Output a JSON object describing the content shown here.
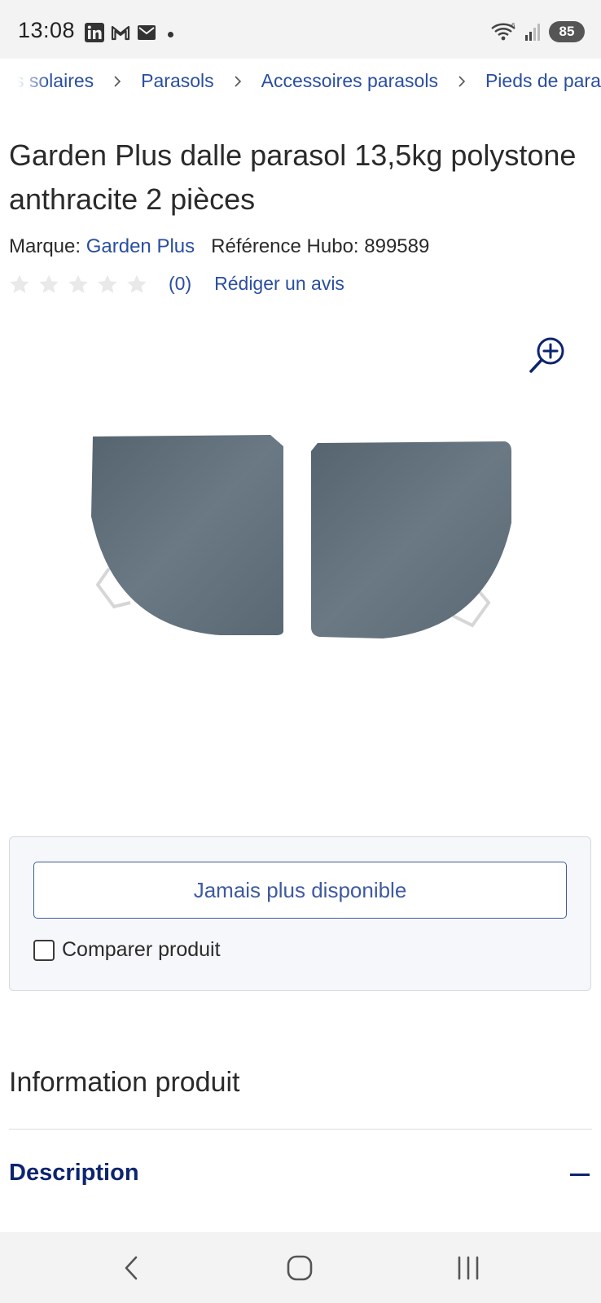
{
  "status_bar": {
    "time": "13:08",
    "notification_icons": [
      "linkedin-icon",
      "gmail-icon",
      "mail-icon"
    ],
    "battery": "85",
    "system_icons": [
      "wifi-icon",
      "signal-icon",
      "battery-icon"
    ]
  },
  "breadcrumb": {
    "items": [
      "s solaires",
      "Parasols",
      "Accessoires parasols",
      "Pieds de parasol"
    ]
  },
  "product": {
    "title": "Garden Plus dalle parasol 13,5kg polystone anthracite 2 pièces",
    "brand_label": "Marque:",
    "brand": "Garden Plus",
    "reference_label": "Référence Hubo:",
    "reference": "899589",
    "rating": {
      "stars_filled": 0,
      "stars_total": 5,
      "review_count": "(0)",
      "write_review": "Rédiger un avis"
    }
  },
  "purchase": {
    "availability_button": "Jamais plus disponible",
    "compare_label": "Comparer produit",
    "compare_checked": false
  },
  "info": {
    "heading": "Information produit",
    "description_title": "Description"
  },
  "colors": {
    "link": "#2a4ea0",
    "heading_dark": "#0d2470",
    "box_background": "#f6f7fa"
  }
}
